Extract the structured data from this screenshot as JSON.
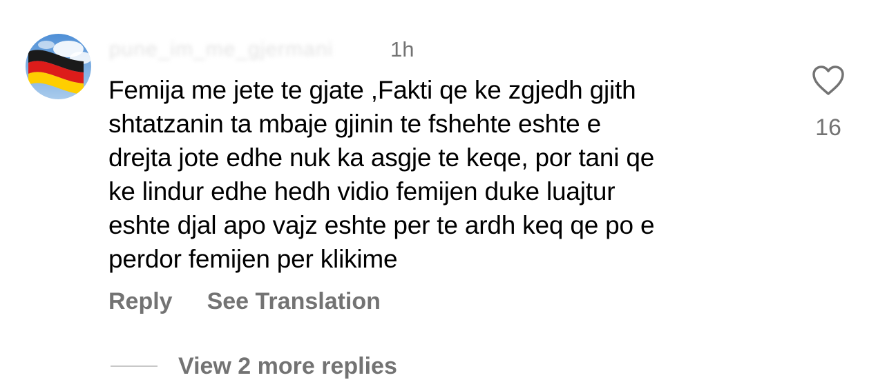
{
  "comment": {
    "avatar_icon": "germany-flag-icon",
    "username": "pune_im_me_gjermani",
    "timestamp": "1h",
    "text": "Femija me jete te gjate ,Fakti qe ke zgjedh gjith\nshtatzanin ta mbaje gjinin te fshehte eshte e\ndrejta jote edhe nuk ka asgje te keqe, por tani qe\nke lindur edhe hedh vidio femijen duke luajtur\neshte djal apo vajz eshte per te ardh keq qe po e\nperdor femijen per klikime",
    "like_count": "16",
    "like_icon": "heart-outline-icon"
  },
  "actions": {
    "reply_label": "Reply",
    "translate_label": "See Translation"
  },
  "replies": {
    "view_more_label": "View 2 more replies"
  },
  "colors": {
    "text_primary": "#000000",
    "text_secondary": "#737373",
    "background": "#ffffff",
    "flag_black": "#1a1a1a",
    "flag_red": "#dd1c1a",
    "flag_gold": "#ffce00",
    "sky": "#6fa6dc"
  }
}
